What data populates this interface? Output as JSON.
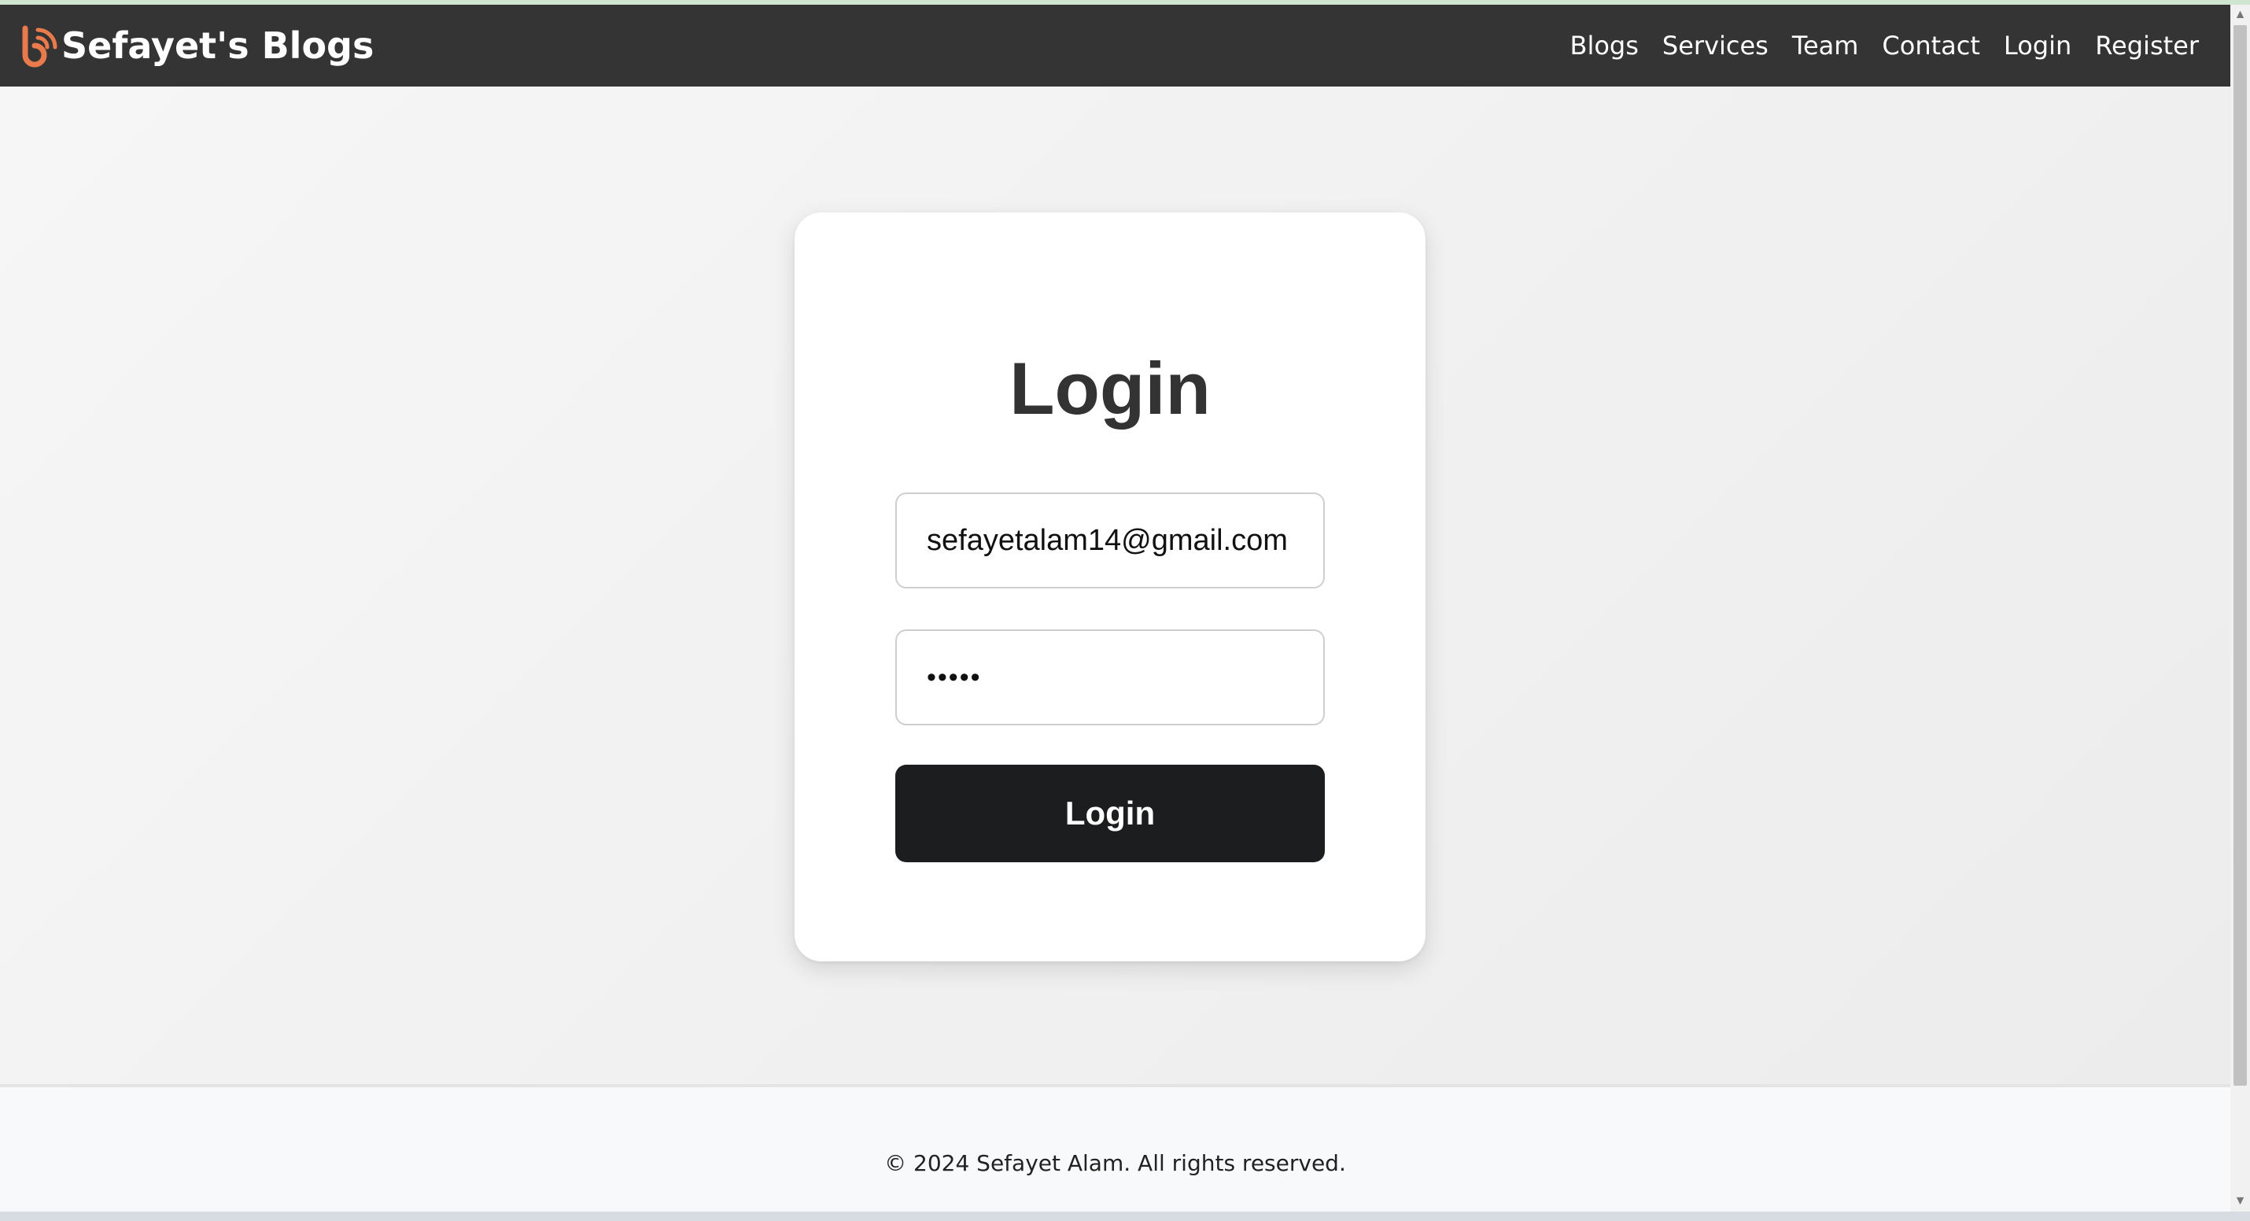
{
  "navbar": {
    "brand_icon": "blog-logo-icon",
    "brand_text": "Sefayet's Blogs",
    "links": [
      "Blogs",
      "Services",
      "Team",
      "Contact",
      "Login",
      "Register"
    ]
  },
  "login_card": {
    "title": "Login",
    "email_value": "sefayetalam14@gmail.com",
    "password_value": "•••••",
    "submit_label": "Login"
  },
  "footer": {
    "copyright": "© 2024 Sefayet Alam. All rights reserved."
  },
  "scrollbar": {
    "up_icon": "scroll-up-arrow-icon",
    "down_icon": "scroll-down-arrow-icon"
  },
  "colors": {
    "navbar_bg": "#343434",
    "brand_accent": "#e87a4c",
    "button_bg": "#1c1d1f",
    "card_bg": "#ffffff"
  }
}
